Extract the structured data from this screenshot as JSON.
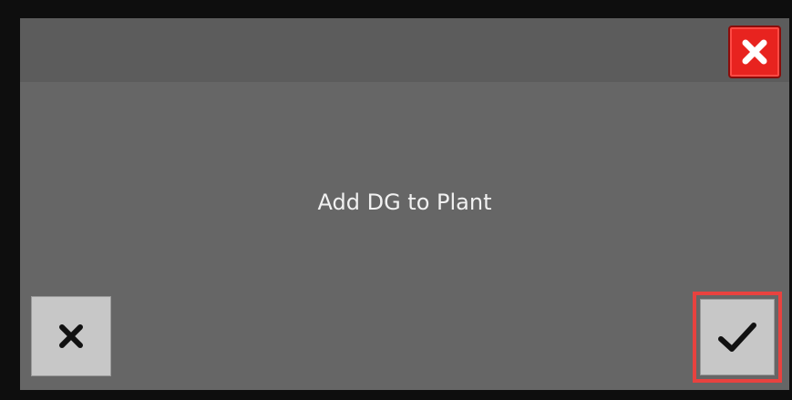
{
  "dialog": {
    "message": "Add DG to Plant",
    "close_icon": "close-icon",
    "cancel_icon": "cancel-x-icon",
    "confirm_icon": "checkmark-icon",
    "colors": {
      "dialog_background": "#666666",
      "close_button": "#e8231f",
      "action_button": "#c7c7c7",
      "highlight": "#e8423f"
    }
  }
}
